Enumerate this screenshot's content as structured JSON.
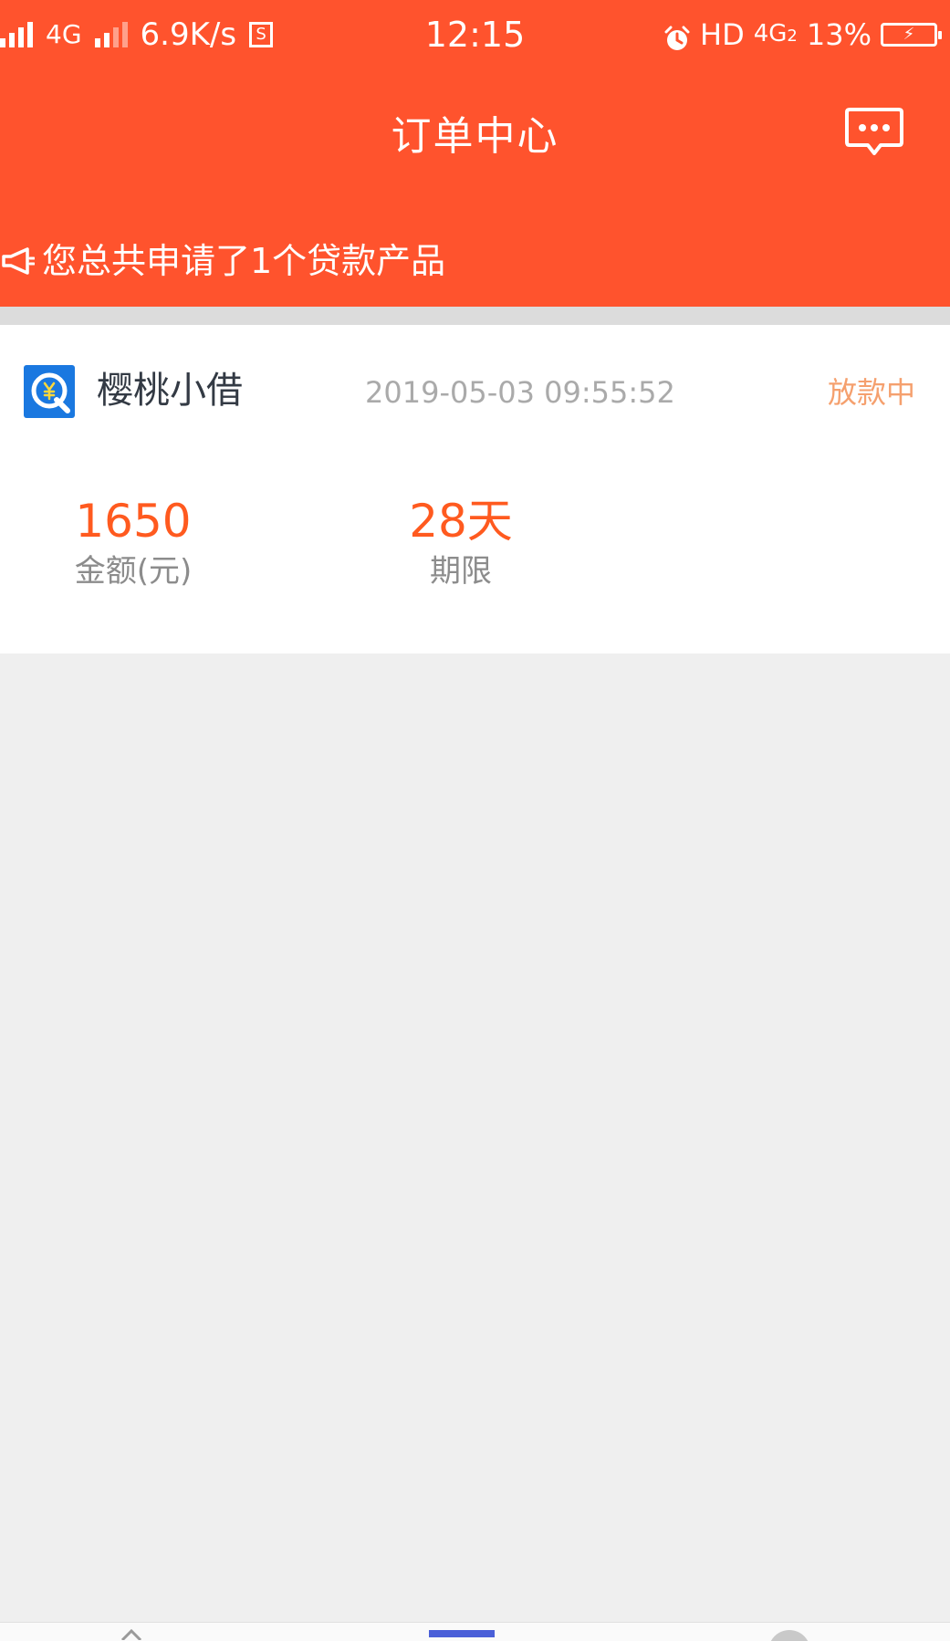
{
  "status_bar": {
    "network_left": "4G",
    "network_speed": "6.9K/s",
    "sim_icon_label": "S",
    "time": "12:15",
    "hd_label": "HD",
    "network_right": "4G",
    "network_right_sub": "2",
    "battery": "13%"
  },
  "header": {
    "title": "订单中心",
    "notice": "您总共申请了1个贷款产品"
  },
  "order": {
    "product_name": "樱桃小借",
    "time": "2019-05-03 09:55:52",
    "status": "放款中",
    "amount_value": "1650",
    "amount_label": "金额(元)",
    "term_value": "28天",
    "term_label": "期限"
  },
  "colors": {
    "brand": "#ff532d",
    "accent": "#ff5a1f",
    "status": "#f5a06e"
  },
  "icons": {
    "chat": "chat-bubble-icon",
    "notice": "megaphone-icon",
    "logo": "cherry-loan-logo-icon"
  }
}
